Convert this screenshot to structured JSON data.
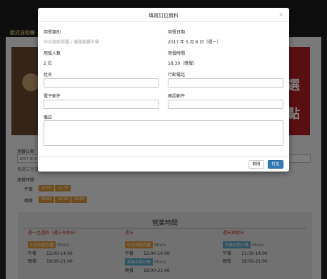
{
  "background": {
    "nav_label": "歐式自助餐",
    "banner_chars": [
      "選",
      "點"
    ],
    "date_label": "用餐日期",
    "date_value": "2017 年 5",
    "date_note": "每週三至日",
    "time_label": "用餐時間",
    "lunch_label": "午餐",
    "dinner_label": "晚餐",
    "lunch_slots": [
      "12:00",
      "12:30"
    ],
    "dinner_slots": [
      "18:00",
      "18:30",
      "19:00"
    ],
    "hours_title": "營業時間",
    "hours_columns": [
      {
        "head": "週一至週四（週三有休日）",
        "tag": "中式自助百匯",
        "tag_color": "orange",
        "more": "More...",
        "rows": [
          [
            "午餐",
            "12:00-14:00"
          ],
          [
            "晚餐",
            "18:00-21:00"
          ]
        ]
      },
      {
        "head": "週五",
        "tag": "中式自助百匯",
        "tag_color": "orange",
        "more": "More...",
        "rows": [
          [
            "午餐",
            "12:00-14:00"
          ]
        ],
        "tag2": "和風自助日韓",
        "more2": "More...",
        "rows2": [
          [
            "晚餐",
            "18:00-21:00"
          ]
        ]
      },
      {
        "head": "週末與假日",
        "tag": "和風自助日韓",
        "tag_color": "blue",
        "more": "More...",
        "rows": [
          [
            "午餐",
            "11:30-14:00"
          ],
          [
            "晚餐",
            "18:00-21:00"
          ]
        ]
      }
    ]
  },
  "modal": {
    "title": "填寫訂位資料",
    "close_glyph": "×",
    "meal_type_label": "用餐類別",
    "meal_type_value": "中式自助百匯 / 埔頂美饌午餐",
    "meal_date_label": "用餐日期",
    "meal_date_value": "2017 年 5 月 8 日（週一）",
    "party_label": "用餐人數",
    "party_value": "2 位",
    "meal_time_label": "用餐時間",
    "meal_time_value": "18:30（晚餐）",
    "name_label": "姓名",
    "mobile_label": "行動電話",
    "email_label": "電子郵件",
    "email_confirm_label": "確認郵件",
    "notes_label": "備註",
    "close_button": "關閉",
    "book_button": "訂位"
  },
  "colors": {
    "primary_button": "#337ab7",
    "banner_red": "#b21d22",
    "tag_orange": "#e39b3b",
    "tag_blue": "#5aa7c2",
    "nav_gold": "#c9b26e"
  }
}
